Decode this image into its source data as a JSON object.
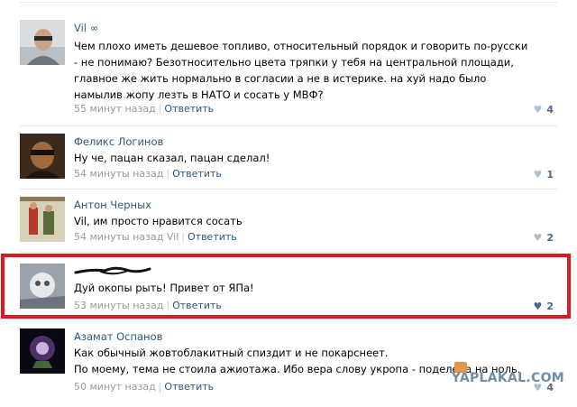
{
  "comments": [
    {
      "author": "Vil ∞",
      "text": "Чем плохо иметь дешевое топливо, относительный порядок и говорить по-русски - не понимаю? Безотносительно цвета тряпки у тебя на центральной площади, главное же жить нормально в согласии а не в истерике. на хуй надо было намылив жопу лезть в НАТО и сосать у МВФ?",
      "time": "55 минут назад",
      "reply": "Ответить",
      "likes": "4"
    },
    {
      "author": "Феликс Логинов",
      "text": "Ну че, пацан сказал, пацан сделал!",
      "time": "54 минуты назад",
      "reply": "Ответить",
      "likes": "1"
    },
    {
      "author": "Антон Черных",
      "text": "Vil, им просто нравится сосать",
      "time": "54 минуты назад",
      "to": "Vil",
      "reply": "Ответить",
      "likes": "2"
    },
    {
      "author": "",
      "text": "Дуй окопы рыть! Привет от ЯПа!",
      "time": "53 минуты назад",
      "reply": "Ответить",
      "likes": "2"
    },
    {
      "author": "Азамат Оспанов",
      "text": "Как обычный жовтоблакитный спиздит и не покарснеет.\nПо моему, тема не стоила ажиотажа. Ибо вера слову укропа - поделена на ноль.",
      "time": "50 минут назад",
      "reply": "Ответить",
      "likes": "4"
    }
  ],
  "watermark": "YAPLAKAL.COM",
  "colors": {
    "link": "#2b587a",
    "meta": "#999999",
    "highlight": "#e4171e",
    "separator": "#e7eaed"
  }
}
